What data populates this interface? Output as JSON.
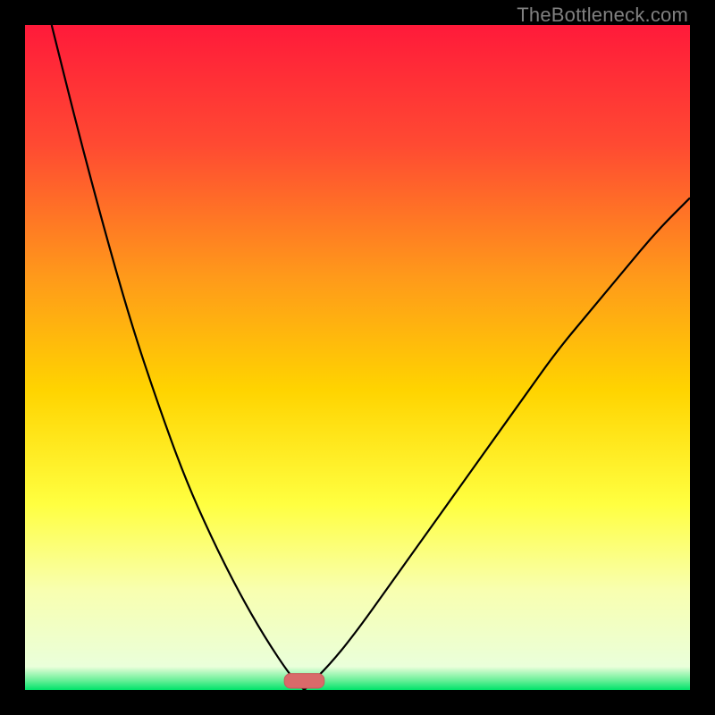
{
  "watermark": {
    "text": "TheBottleneck.com"
  },
  "colors": {
    "black": "#000000",
    "curve": "#000000",
    "gradient_top": "#ff1a3a",
    "gradient_mid_upper": "#ff7a2a",
    "gradient_mid": "#ffd400",
    "gradient_mid_lower": "#ffff66",
    "gradient_pale": "#f6ffc8",
    "gradient_green": "#00e36a",
    "marker_fill": "#d96a6a",
    "marker_stroke": "#c85a5a"
  },
  "chart_data": {
    "type": "line",
    "title": "",
    "xlabel": "",
    "ylabel": "",
    "xlim": [
      0,
      100
    ],
    "ylim": [
      0,
      100
    ],
    "x_optimum": 42,
    "series": [
      {
        "name": "left-branch",
        "x": [
          4,
          8,
          12,
          16,
          20,
          24,
          28,
          32,
          36,
          40,
          42
        ],
        "values": [
          100,
          84,
          69,
          55,
          43,
          32,
          23,
          15,
          8,
          2,
          0
        ]
      },
      {
        "name": "right-branch",
        "x": [
          42,
          46,
          50,
          55,
          60,
          65,
          70,
          75,
          80,
          85,
          90,
          95,
          100
        ],
        "values": [
          0,
          4,
          9,
          16,
          23,
          30,
          37,
          44,
          51,
          57,
          63,
          69,
          74
        ]
      }
    ],
    "marker": {
      "x_center": 42,
      "width": 6,
      "height": 2.2
    },
    "gradient_stops": [
      {
        "offset": 0.0,
        "color": "#ff1a3a"
      },
      {
        "offset": 0.18,
        "color": "#ff4a32"
      },
      {
        "offset": 0.38,
        "color": "#ff9a1a"
      },
      {
        "offset": 0.55,
        "color": "#ffd400"
      },
      {
        "offset": 0.72,
        "color": "#ffff40"
      },
      {
        "offset": 0.85,
        "color": "#f8ffb0"
      },
      {
        "offset": 0.965,
        "color": "#eaffda"
      },
      {
        "offset": 0.985,
        "color": "#6cf09a"
      },
      {
        "offset": 1.0,
        "color": "#00e36a"
      }
    ]
  }
}
